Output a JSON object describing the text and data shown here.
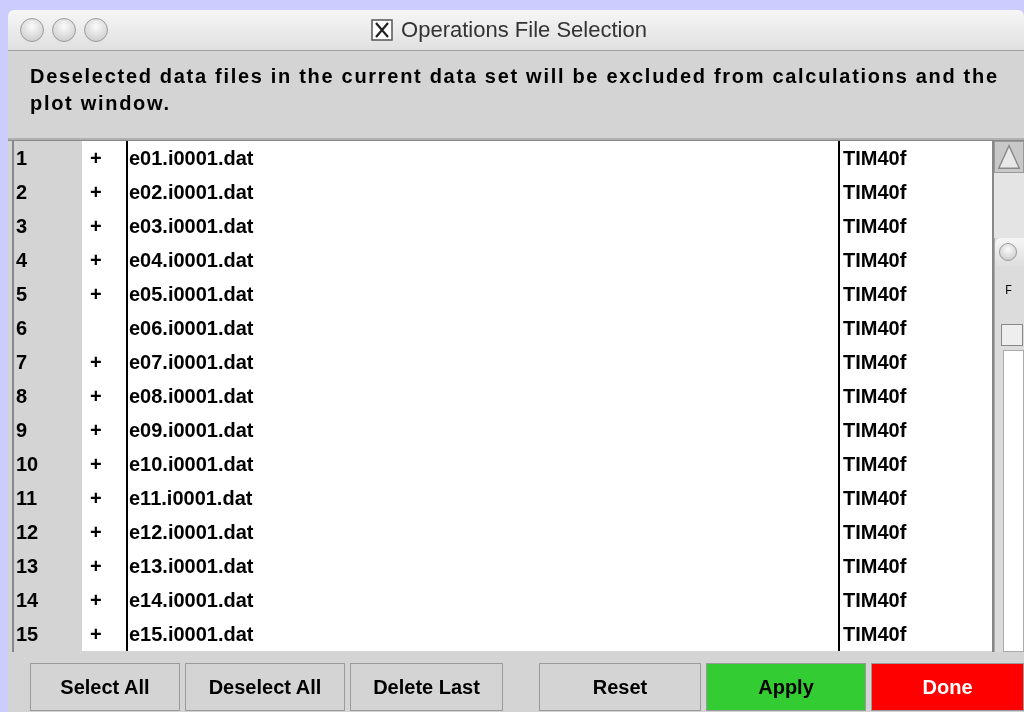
{
  "window": {
    "title": "Operations File Selection"
  },
  "message": "Deselected data files in the current data set will be excluded from calculations and the plot window.",
  "files": [
    {
      "number": "1",
      "mark": "+",
      "name": "e01.i0001.dat",
      "type": "TIM40f"
    },
    {
      "number": "2",
      "mark": "+",
      "name": "e02.i0001.dat",
      "type": "TIM40f"
    },
    {
      "number": "3",
      "mark": "+",
      "name": "e03.i0001.dat",
      "type": "TIM40f"
    },
    {
      "number": "4",
      "mark": "+",
      "name": "e04.i0001.dat",
      "type": "TIM40f"
    },
    {
      "number": "5",
      "mark": "+",
      "name": "e05.i0001.dat",
      "type": "TIM40f"
    },
    {
      "number": "6",
      "name": "e06.i0001.dat",
      "type": "TIM40f"
    },
    {
      "number": "7",
      "mark": "+",
      "name": "e07.i0001.dat",
      "type": "TIM40f"
    },
    {
      "number": "8",
      "mark": "+",
      "name": "e08.i0001.dat",
      "type": "TIM40f"
    },
    {
      "number": "9",
      "mark": "+",
      "name": "e09.i0001.dat",
      "type": "TIM40f"
    },
    {
      "number": "10",
      "mark": "+",
      "name": "e10.i0001.dat",
      "type": "TIM40f"
    },
    {
      "number": "11",
      "mark": "+",
      "name": "e11.i0001.dat",
      "type": "TIM40f"
    },
    {
      "number": "12",
      "mark": "+",
      "name": "e12.i0001.dat",
      "type": "TIM40f"
    },
    {
      "number": "13",
      "mark": "+",
      "name": "e13.i0001.dat",
      "type": "TIM40f"
    },
    {
      "number": "14",
      "mark": "+",
      "name": "e14.i0001.dat",
      "type": "TIM40f"
    },
    {
      "number": "15",
      "mark": "+",
      "name": "e15.i0001.dat",
      "type": "TIM40f"
    }
  ],
  "buttons": [
    {
      "label": "Select All",
      "kind": "normal"
    },
    {
      "label": "Deselect All",
      "kind": "normal"
    },
    {
      "label": "Delete Last",
      "kind": "normal"
    },
    {
      "label": "Reset",
      "kind": "normal"
    },
    {
      "label": "Apply",
      "kind": "apply"
    },
    {
      "label": "Done",
      "kind": "done"
    }
  ],
  "background_window": {
    "label": "F"
  }
}
